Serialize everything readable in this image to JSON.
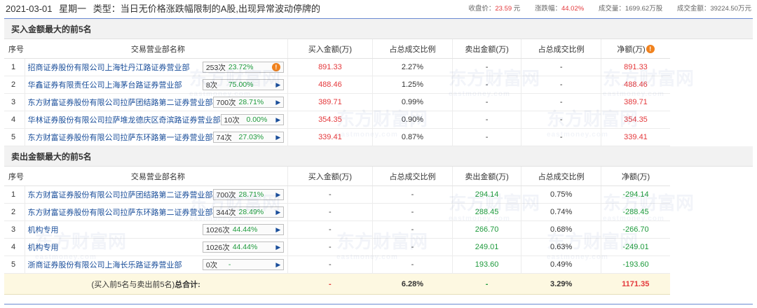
{
  "header": {
    "date": "2021-03-01",
    "weekday": "星期一",
    "type_text": "类型：当日无价格涨跌幅限制的A股,出现异常波动停牌的",
    "stats": [
      {
        "label": "收盘价：",
        "value": "23.59",
        "unit": "元"
      },
      {
        "label": "涨跌幅：",
        "value": "44.02%",
        "unit": ""
      },
      {
        "label": "成交量：",
        "value": "1699.62",
        "unit": "万股"
      },
      {
        "label": "成交金额：",
        "value": "39224.50",
        "unit": "万元"
      }
    ]
  },
  "columns": {
    "idx": "序号",
    "name": "交易营业部名称",
    "buy": "买入金额(万)",
    "buy_pct": "占总成交比例",
    "sell": "卖出金额(万)",
    "sell_pct": "占总成交比例",
    "net_buy": "净额(万)",
    "net_sell": "净额(万)"
  },
  "buy_section": {
    "title": "买入金额最大的前5名",
    "rows": [
      {
        "idx": "1",
        "name": "招商证券股份有限公司上海牡丹江路证券营业部",
        "count": "253次",
        "pct": "23.72%",
        "warn": true,
        "buy": "891.33",
        "buy_pct": "2.27%",
        "sell": "-",
        "sell_pct": "-",
        "net": "891.33"
      },
      {
        "idx": "2",
        "name": "华鑫证券有限责任公司上海茅台路证券营业部",
        "count": "8次",
        "pct": "75.00%",
        "warn": false,
        "buy": "488.46",
        "buy_pct": "1.25%",
        "sell": "-",
        "sell_pct": "-",
        "net": "488.46"
      },
      {
        "idx": "3",
        "name": "东方财富证券股份有限公司拉萨团结路第二证券营业部",
        "count": "700次",
        "pct": "28.71%",
        "warn": false,
        "buy": "389.71",
        "buy_pct": "0.99%",
        "sell": "-",
        "sell_pct": "-",
        "net": "389.71"
      },
      {
        "idx": "4",
        "name": "华林证券股份有限公司拉萨堆龙德庆区奇滨路证券营业部",
        "count": "10次",
        "pct": "0.00%",
        "warn": false,
        "buy": "354.35",
        "buy_pct": "0.90%",
        "sell": "-",
        "sell_pct": "-",
        "net": "354.35"
      },
      {
        "idx": "5",
        "name": "东方财富证券股份有限公司拉萨东环路第一证券营业部",
        "count": "74次",
        "pct": "27.03%",
        "warn": false,
        "buy": "339.41",
        "buy_pct": "0.87%",
        "sell": "-",
        "sell_pct": "-",
        "net": "339.41"
      }
    ]
  },
  "sell_section": {
    "title": "卖出金额最大的前5名",
    "rows": [
      {
        "idx": "1",
        "name": "东方财富证券股份有限公司拉萨团结路第二证券营业部",
        "count": "700次",
        "pct": "28.71%",
        "buy": "-",
        "buy_pct": "-",
        "sell": "294.14",
        "sell_pct": "0.75%",
        "net": "-294.14"
      },
      {
        "idx": "2",
        "name": "东方财富证券股份有限公司拉萨东环路第二证券营业部",
        "count": "344次",
        "pct": "28.49%",
        "buy": "-",
        "buy_pct": "-",
        "sell": "288.45",
        "sell_pct": "0.74%",
        "net": "-288.45"
      },
      {
        "idx": "3",
        "name": "机构专用",
        "count": "1026次",
        "pct": "44.44%",
        "buy": "-",
        "buy_pct": "-",
        "sell": "266.70",
        "sell_pct": "0.68%",
        "net": "-266.70"
      },
      {
        "idx": "4",
        "name": "机构专用",
        "count": "1026次",
        "pct": "44.44%",
        "buy": "-",
        "buy_pct": "-",
        "sell": "249.01",
        "sell_pct": "0.63%",
        "net": "-249.01"
      },
      {
        "idx": "5",
        "name": "浙商证券股份有限公司上海长乐路证券营业部",
        "count": "0次",
        "pct": "-",
        "buy": "-",
        "buy_pct": "-",
        "sell": "193.60",
        "sell_pct": "0.49%",
        "net": "-193.60"
      }
    ]
  },
  "total": {
    "label_prefix": "(买入前5名与卖出前5名)",
    "label_bold": "总合计:",
    "buy": "-",
    "buy_pct": "6.28%",
    "sell": "-",
    "sell_pct": "3.29%",
    "net": "1171.35"
  },
  "icons": {
    "warn": "!",
    "arrow": "▶"
  },
  "watermark": {
    "text": "东方财富网",
    "sub": "eastmoney.com"
  },
  "colors": {
    "up": "#e4393c",
    "down": "#1d9a3b",
    "link": "#1a4e9a",
    "total_bg": "#fdf8e1"
  }
}
